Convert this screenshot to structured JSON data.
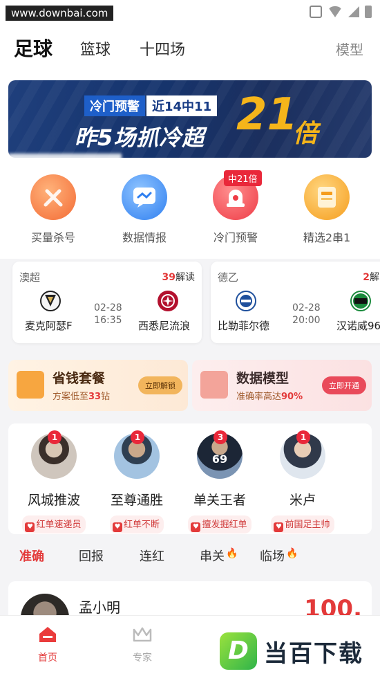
{
  "status_bar": {
    "watermark": "www.downbai.com"
  },
  "top_tabs": {
    "football": "足球",
    "basketball": "篮球",
    "fourteen": "十四场",
    "model": "模型"
  },
  "banner": {
    "tag1": "冷门预警",
    "tag2": "近14中11",
    "main": "昨5场抓冷超",
    "big": "21",
    "suffix": "倍"
  },
  "quick_actions": [
    {
      "label": "买量杀号",
      "icon": "sword-icon"
    },
    {
      "label": "数据情报",
      "icon": "chat-icon"
    },
    {
      "label": "冷门预警",
      "icon": "alarm-icon",
      "chip": "中21倍"
    },
    {
      "label": "精选2串1",
      "icon": "ticket-icon"
    }
  ],
  "matches": [
    {
      "league": "澳超",
      "count": "39",
      "count_suffix": "解读",
      "home": "麦克阿瑟F",
      "away": "西悉尼流浪",
      "date": "02-28",
      "time": "16:35"
    },
    {
      "league": "德乙",
      "count": "2",
      "count_suffix": "解",
      "home": "比勒菲尔德",
      "away": "汉诺威96",
      "date": "02-28",
      "time": "20:00"
    }
  ],
  "promos": [
    {
      "title": "省钱套餐",
      "sub_prefix": "方案低至",
      "sub_value": "33",
      "sub_suffix": "钻",
      "button": "立即解锁",
      "icon": "coupon-icon"
    },
    {
      "title": "数据模型",
      "sub_prefix": "准确率高达",
      "sub_value": "90%",
      "sub_suffix": "",
      "button": "立即开通",
      "icon": "cube-chart-icon"
    }
  ],
  "experts": [
    {
      "name": "风城推波",
      "tag": "红单速递员",
      "badge": "1"
    },
    {
      "name": "至尊通胜",
      "tag": "红单不断",
      "badge": "1"
    },
    {
      "name": "单关王者",
      "tag": "擅发掘红单",
      "badge": "3",
      "jersey": "69"
    },
    {
      "name": "米卢",
      "tag": "前国足主帅",
      "badge": "1"
    }
  ],
  "filters": [
    {
      "label": "准确",
      "active": true
    },
    {
      "label": "回报"
    },
    {
      "label": "连红"
    },
    {
      "label": "串关",
      "hot": true
    },
    {
      "label": "临场",
      "hot": true
    }
  ],
  "post": {
    "name": "孟小明",
    "odds": "100."
  },
  "bottom_nav": {
    "home": "首页",
    "expert": "专家"
  },
  "logo": {
    "letter": "D",
    "text": "当百下载"
  },
  "colors": {
    "accent": "#e33a3a",
    "banner_blue": "#1f3f7c",
    "gold": "#f5b51a"
  }
}
